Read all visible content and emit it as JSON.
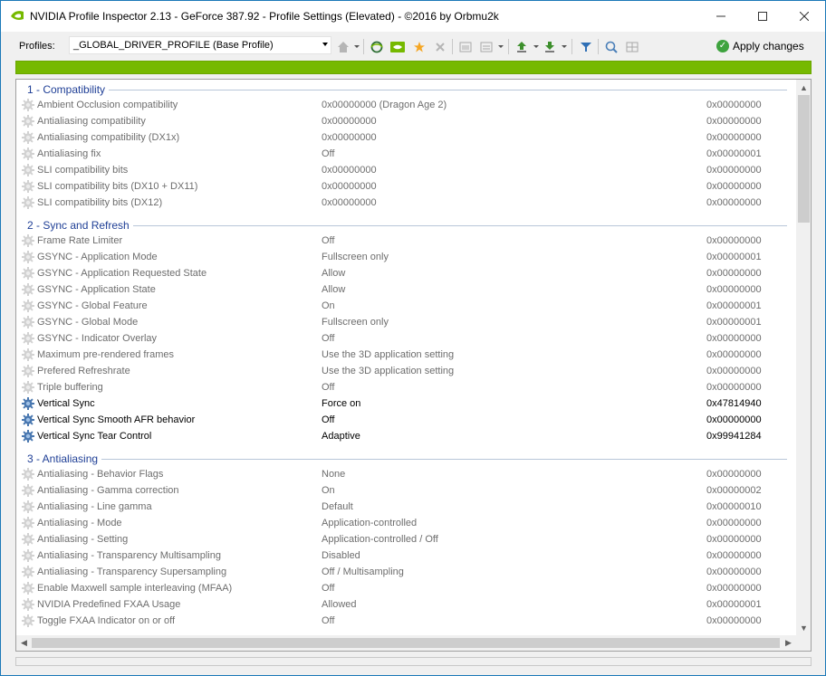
{
  "window": {
    "title": "NVIDIA Profile Inspector 2.13 - GeForce 387.92 - Profile Settings (Elevated) - ©2016 by Orbmu2k"
  },
  "toolbar": {
    "profiles_label": "Profiles:",
    "selected_profile": "_GLOBAL_DRIVER_PROFILE (Base Profile)",
    "apply_label": "Apply changes",
    "icons": [
      "home-icon",
      "refresh-icon",
      "nvidia-logo-icon",
      "new-profile-icon",
      "delete-profile-icon",
      "add-app-icon",
      "export-icon",
      "import-icon",
      "filter-icon",
      "scan-icon",
      "settings-grid-icon"
    ]
  },
  "colors": {
    "accent_green": "#76b900",
    "group_header": "#1f3f96",
    "inactive_text": "#6d6d6d",
    "active_text": "#000000"
  },
  "groups": [
    {
      "title": "1 - Compatibility",
      "rows": [
        {
          "name": "Ambient Occlusion compatibility",
          "value": "0x00000000 (Dragon Age 2)",
          "hex": "0x00000000",
          "custom": false
        },
        {
          "name": "Antialiasing compatibility",
          "value": "0x00000000",
          "hex": "0x00000000",
          "custom": false
        },
        {
          "name": "Antialiasing compatibility (DX1x)",
          "value": "0x00000000",
          "hex": "0x00000000",
          "custom": false
        },
        {
          "name": "Antialiasing fix",
          "value": "Off",
          "hex": "0x00000001",
          "custom": false
        },
        {
          "name": "SLI compatibility bits",
          "value": "0x00000000",
          "hex": "0x00000000",
          "custom": false
        },
        {
          "name": "SLI compatibility bits (DX10 + DX11)",
          "value": "0x00000000",
          "hex": "0x00000000",
          "custom": false
        },
        {
          "name": "SLI compatibility bits (DX12)",
          "value": "0x00000000",
          "hex": "0x00000000",
          "custom": false
        }
      ]
    },
    {
      "title": "2 - Sync and Refresh",
      "rows": [
        {
          "name": "Frame Rate Limiter",
          "value": "Off",
          "hex": "0x00000000",
          "custom": false
        },
        {
          "name": "GSYNC - Application Mode",
          "value": "Fullscreen only",
          "hex": "0x00000001",
          "custom": false
        },
        {
          "name": "GSYNC - Application Requested State",
          "value": "Allow",
          "hex": "0x00000000",
          "custom": false
        },
        {
          "name": "GSYNC - Application State",
          "value": "Allow",
          "hex": "0x00000000",
          "custom": false
        },
        {
          "name": "GSYNC - Global Feature",
          "value": "On",
          "hex": "0x00000001",
          "custom": false
        },
        {
          "name": "GSYNC - Global Mode",
          "value": "Fullscreen only",
          "hex": "0x00000001",
          "custom": false
        },
        {
          "name": "GSYNC - Indicator Overlay",
          "value": "Off",
          "hex": "0x00000000",
          "custom": false
        },
        {
          "name": "Maximum pre-rendered frames",
          "value": "Use the 3D application setting",
          "hex": "0x00000000",
          "custom": false
        },
        {
          "name": "Prefered Refreshrate",
          "value": "Use the 3D application setting",
          "hex": "0x00000000",
          "custom": false
        },
        {
          "name": "Triple buffering",
          "value": "Off",
          "hex": "0x00000000",
          "custom": false
        },
        {
          "name": "Vertical Sync",
          "value": "Force on",
          "hex": "0x47814940",
          "custom": true
        },
        {
          "name": "Vertical Sync Smooth AFR behavior",
          "value": "Off",
          "hex": "0x00000000",
          "custom": true
        },
        {
          "name": "Vertical Sync Tear Control",
          "value": "Adaptive",
          "hex": "0x99941284",
          "custom": true
        }
      ]
    },
    {
      "title": "3 - Antialiasing",
      "rows": [
        {
          "name": "Antialiasing - Behavior Flags",
          "value": "None",
          "hex": "0x00000000",
          "custom": false
        },
        {
          "name": "Antialiasing - Gamma correction",
          "value": "On",
          "hex": "0x00000002",
          "custom": false
        },
        {
          "name": "Antialiasing - Line gamma",
          "value": "Default",
          "hex": "0x00000010",
          "custom": false
        },
        {
          "name": "Antialiasing - Mode",
          "value": "Application-controlled",
          "hex": "0x00000000",
          "custom": false
        },
        {
          "name": "Antialiasing - Setting",
          "value": "Application-controlled / Off",
          "hex": "0x00000000",
          "custom": false
        },
        {
          "name": "Antialiasing - Transparency Multisampling",
          "value": "Disabled",
          "hex": "0x00000000",
          "custom": false
        },
        {
          "name": "Antialiasing - Transparency Supersampling",
          "value": "Off / Multisampling",
          "hex": "0x00000000",
          "custom": false
        },
        {
          "name": "Enable Maxwell sample interleaving (MFAA)",
          "value": "Off",
          "hex": "0x00000000",
          "custom": false
        },
        {
          "name": "NVIDIA Predefined FXAA Usage",
          "value": "Allowed",
          "hex": "0x00000001",
          "custom": false
        },
        {
          "name": "Toggle FXAA Indicator on or off",
          "value": "Off",
          "hex": "0x00000000",
          "custom": false
        }
      ]
    }
  ]
}
